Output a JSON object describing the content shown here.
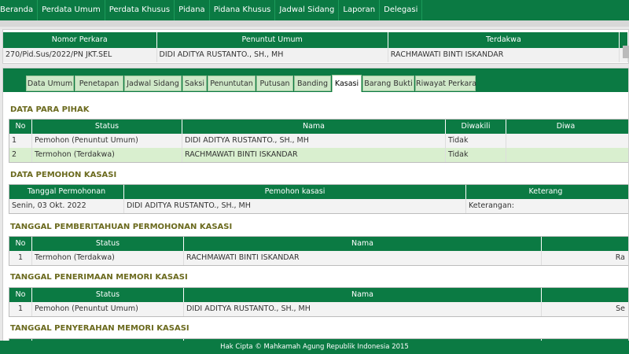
{
  "nav": {
    "items": [
      "Beranda",
      "Perdata Umum",
      "Perdata Khusus",
      "Pidana",
      "Pidana Khusus",
      "Jadwal Sidang",
      "Laporan",
      "Delegasi"
    ]
  },
  "case": {
    "headers": [
      "Nomor Perkara",
      "Penuntut Umum",
      "Terdakwa"
    ],
    "row": [
      "270/Pid.Sus/2022/PN JKT.SEL",
      "DIDI ADITYA RUSTANTO., SH., MH",
      "RACHMAWATI BINTI ISKANDAR"
    ]
  },
  "tabs": {
    "items": [
      "Data Umum",
      "Penetapan",
      "Jadwal Sidang",
      "Saksi",
      "Penuntutan",
      "Putusan",
      "Banding",
      "Kasasi",
      "Barang Bukti",
      "Riwayat Perkara"
    ],
    "active": "Kasasi"
  },
  "pihak": {
    "title": "DATA PARA PIHAK",
    "headers": [
      "No",
      "Status",
      "Nama",
      "Diwakili",
      "Diwa"
    ],
    "rows": [
      [
        "1",
        "Pemohon (Penuntut Umum)",
        "DIDI ADITYA RUSTANTO., SH., MH",
        "Tidak",
        ""
      ],
      [
        "2",
        "Termohon (Terdakwa)",
        "RACHMAWATI BINTI ISKANDAR",
        "Tidak",
        ""
      ]
    ]
  },
  "pemohon": {
    "title": "DATA PEMOHON KASASI",
    "headers": [
      "Tanggal Permohonan",
      "Pemohon kasasi",
      "Keterang"
    ],
    "row": [
      "Senin, 03 Okt. 2022",
      "DIDI ADITYA RUSTANTO., SH., MH",
      "Keterangan:"
    ]
  },
  "pemberitahuan": {
    "title": "TANGGAL PEMBERITAHUAN PERMOHONAN KASASI",
    "headers": [
      "No",
      "Status",
      "Nama",
      ""
    ],
    "row": [
      "1",
      "Termohon (Terdakwa)",
      "RACHMAWATI BINTI ISKANDAR",
      "Ra"
    ]
  },
  "penerimaan": {
    "title": "TANGGAL PENERIMAAN MEMORI KASASI",
    "headers": [
      "No",
      "Status",
      "Nama",
      ""
    ],
    "row": [
      "1",
      "Pemohon (Penuntut Umum)",
      "DIDI ADITYA RUSTANTO., SH., MH",
      "Se"
    ]
  },
  "penyerahan": {
    "title": "TANGGAL PENYERAHAN MEMORI KASASI"
  },
  "footer": {
    "text": "Hak Cipta © Mahkamah Agung Republik Indonesia 2015"
  }
}
